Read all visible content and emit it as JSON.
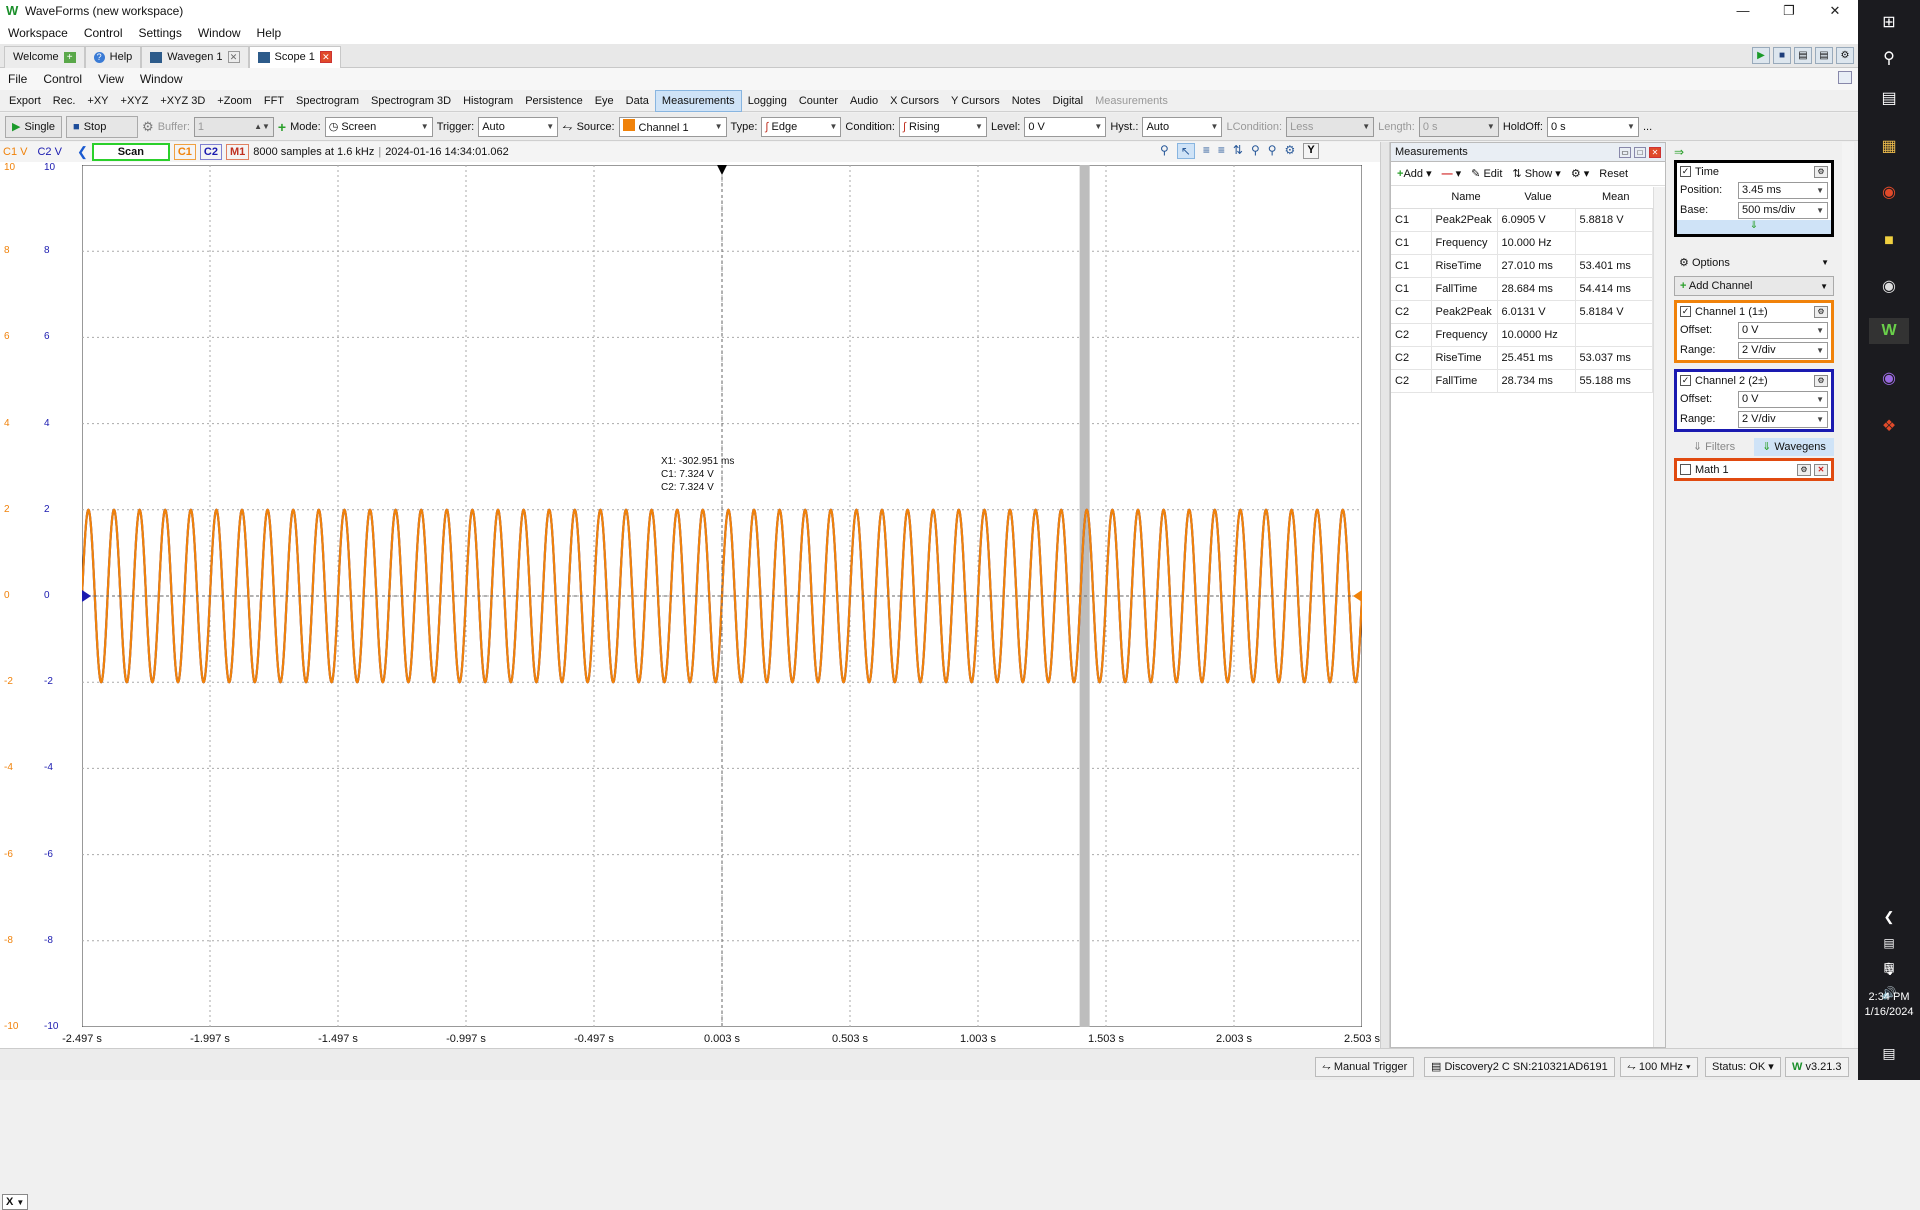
{
  "titlebar": {
    "title": "WaveForms (new workspace)"
  },
  "workspace_menu": [
    "Workspace",
    "Control",
    "Settings",
    "Window",
    "Help"
  ],
  "tabs": [
    {
      "label": "Welcome"
    },
    {
      "label": "Help"
    },
    {
      "label": "Wavegen 1"
    },
    {
      "label": "Scope 1"
    }
  ],
  "file_menu": [
    "File",
    "Control",
    "View",
    "Window"
  ],
  "views": [
    "Export",
    "Rec.",
    "+XY",
    "+XYZ",
    "+XYZ 3D",
    "+Zoom",
    "FFT",
    "Spectrogram",
    "Spectrogram 3D",
    "Histogram",
    "Persistence",
    "Eye",
    "Data",
    "Measurements",
    "Logging",
    "Counter",
    "Audio",
    "X Cursors",
    "Y Cursors",
    "Notes",
    "Digital",
    "Measurements"
  ],
  "control": {
    "single": "Single",
    "stop": "Stop",
    "buffer_label": "Buffer:",
    "buffer_value": "1",
    "mode_label": "Mode:",
    "mode_value": "Screen",
    "trigger_label": "Trigger:",
    "trigger_value": "Auto",
    "source_label": "Source:",
    "source_value": "Channel 1",
    "type_label": "Type:",
    "type_value": "Edge",
    "condition_label": "Condition:",
    "condition_value": "Rising",
    "level_label": "Level:",
    "level_value": "0 V",
    "hyst_label": "Hyst.:",
    "hyst_value": "Auto",
    "lcondition_label": "LCondition:",
    "lcondition_value": "Less",
    "length_label": "Length:",
    "length_value": "0 s",
    "holdoff_label": "HoldOff:",
    "holdoff_value": "0 s",
    "more": "..."
  },
  "scope_info": {
    "c1v": "C1 V",
    "c2v": "C2 V",
    "scan": "Scan",
    "c1": "C1",
    "c2": "C2",
    "m1": "M1",
    "samples": "8000 samples at 1.6 kHz",
    "timestamp": "2024-01-16 14:34:01.062"
  },
  "plot": {
    "yticks": [
      "10",
      "8",
      "6",
      "4",
      "2",
      "0",
      "-2",
      "-4",
      "-6",
      "-8",
      "-10"
    ],
    "xticks": [
      "-2.497 s",
      "-1.997 s",
      "-1.497 s",
      "-0.997 s",
      "-0.497 s",
      "0.003 s",
      "0.503 s",
      "1.003 s",
      "1.503 s",
      "2.003 s",
      "2.503 s"
    ],
    "cursor": "X1: -302.951 ms\nC1: 7.324 V\nC2: 7.324 V",
    "x_axis_btn": "X",
    "y_axis_btn": "Y"
  },
  "chart_data": {
    "type": "line",
    "xlabel": "",
    "ylabel": "",
    "ylim": [
      -10,
      10
    ],
    "xlim": [
      -2.497,
      2.503
    ],
    "x_ticks": [
      "-2.497 s",
      "-1.997 s",
      "-1.497 s",
      "-0.997 s",
      "-0.497 s",
      "0.003 s",
      "0.503 s",
      "1.003 s",
      "1.503 s",
      "2.003 s",
      "2.503 s"
    ],
    "y_ticks": [
      "10",
      "8",
      "6",
      "4",
      "2",
      "0",
      "-2",
      "-4",
      "-6",
      "-8",
      "-10"
    ],
    "grid": true,
    "series": [
      {
        "name": "C1",
        "color": "#f0820a",
        "frequency_hz": 10.0,
        "amplitude_v": 2.0,
        "offset_v": 0
      },
      {
        "name": "C2",
        "color": "#2020b0",
        "frequency_hz": 10.0,
        "amplitude_v": 2.0,
        "offset_v": 0
      }
    ]
  },
  "measurements": {
    "title": "Measurements",
    "tools": [
      "Add",
      "Edit",
      "Show",
      "Reset"
    ],
    "headers": [
      "",
      "Name",
      "Value",
      "Mean"
    ],
    "rows": [
      [
        "C1",
        "Peak2Peak",
        "6.0905 V",
        "5.8818 V"
      ],
      [
        "C1",
        "Frequency",
        "10.000 Hz",
        ""
      ],
      [
        "C1",
        "RiseTime",
        "27.010 ms",
        "53.401 ms"
      ],
      [
        "C1",
        "FallTime",
        "28.684 ms",
        "54.414 ms"
      ],
      [
        "C2",
        "Peak2Peak",
        "6.0131 V",
        "5.8184 V"
      ],
      [
        "C2",
        "Frequency",
        "10.0000 Hz",
        ""
      ],
      [
        "C2",
        "RiseTime",
        "25.451 ms",
        "53.037 ms"
      ],
      [
        "C2",
        "FallTime",
        "28.734 ms",
        "55.188 ms"
      ]
    ]
  },
  "side": {
    "time_label": "Time",
    "position_label": "Position:",
    "position_value": "3.45 ms",
    "base_label": "Base:",
    "base_value": "500 ms/div",
    "options": "Options",
    "add_channel": "Add Channel",
    "ch1_label": "Channel 1 (1±)",
    "ch1_offset": "0 V",
    "ch1_range": "2 V/div",
    "ch2_label": "Channel 2 (2±)",
    "ch2_offset": "0 V",
    "ch2_range": "2 V/div",
    "offset_label": "Offset:",
    "range_label": "Range:",
    "filters": "Filters",
    "wavegens": "Wavegens",
    "math": "Math 1",
    "colors": {
      "time": "#000000",
      "ch1": "#f0820a",
      "ch2": "#1a1ab0",
      "math": "#e04a10"
    }
  },
  "status": {
    "manual_trigger": "Manual Trigger",
    "device": "Discovery2 C SN:210321AD6191",
    "clock": "100 MHz",
    "status": "Status: OK",
    "version": "v3.21.3"
  },
  "taskbar": {
    "time": "2:34 PM",
    "date": "1/16/2024"
  }
}
